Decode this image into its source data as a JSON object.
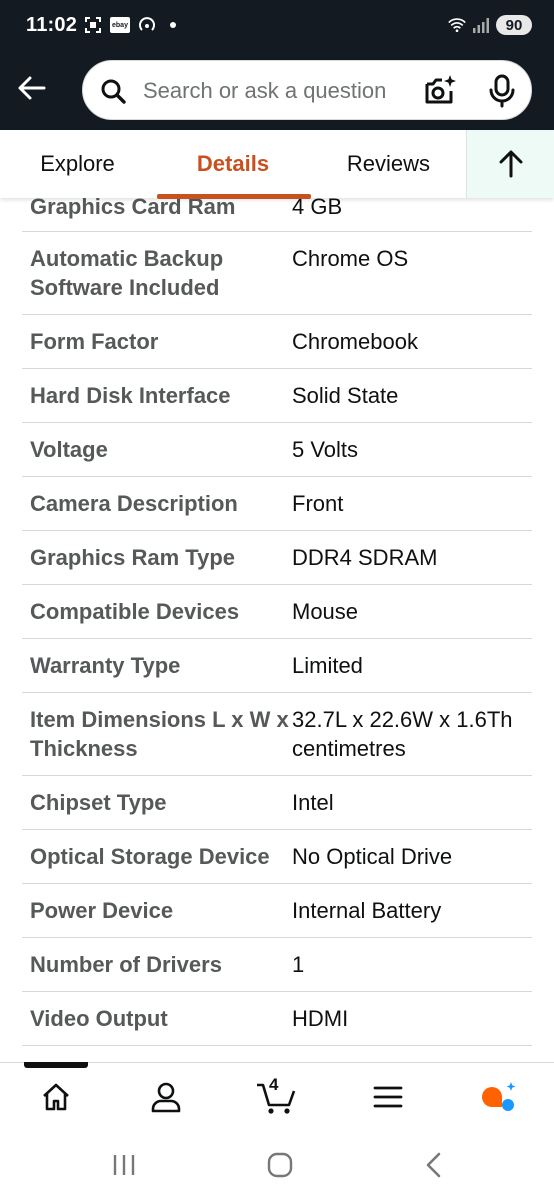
{
  "status_bar": {
    "time": "11:02",
    "ebay_label": "ebay",
    "battery": "90"
  },
  "search": {
    "placeholder": "Search or ask a question"
  },
  "tabs": [
    {
      "label": "Explore"
    },
    {
      "label": "Details",
      "active": true
    },
    {
      "label": "Reviews"
    }
  ],
  "specs": [
    {
      "key": "Graphics Card Ram",
      "value": "4 GB"
    },
    {
      "key": "Automatic Backup Software Included",
      "value": "Chrome OS"
    },
    {
      "key": "Form Factor",
      "value": "Chromebook"
    },
    {
      "key": "Hard Disk Interface",
      "value": "Solid State"
    },
    {
      "key": "Voltage",
      "value": "5 Volts"
    },
    {
      "key": "Camera Description",
      "value": "Front"
    },
    {
      "key": "Graphics Ram Type",
      "value": "DDR4 SDRAM"
    },
    {
      "key": "Compatible Devices",
      "value": "Mouse"
    },
    {
      "key": "Warranty Type",
      "value": "Limited"
    },
    {
      "key": "Item Dimensions L x W x Thickness",
      "value": "32.7L x 22.6W x 1.6Th centimetres"
    },
    {
      "key": "Chipset Type",
      "value": "Intel"
    },
    {
      "key": "Optical Storage Device",
      "value": "No Optical Drive"
    },
    {
      "key": "Power Device",
      "value": "Internal Battery"
    },
    {
      "key": "Number of Drivers",
      "value": "1"
    },
    {
      "key": "Video Output",
      "value": "HDMI"
    }
  ],
  "bottom_nav": {
    "cart_count": "4"
  },
  "colors": {
    "header_bg": "#131a22",
    "accent": "#c7511f",
    "rufus_orange": "#ff6200",
    "rufus_blue": "#1a98ff"
  }
}
